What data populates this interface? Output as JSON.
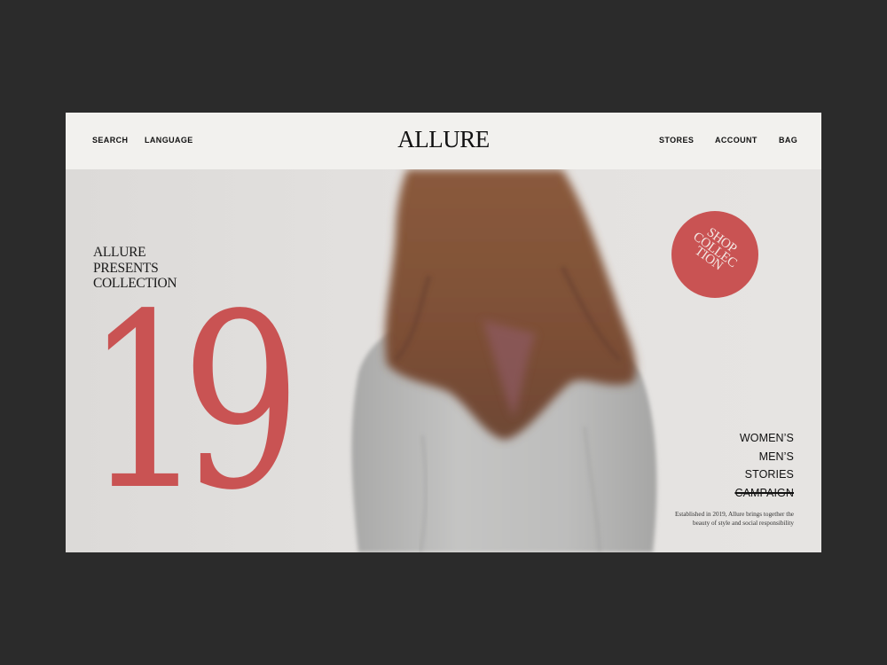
{
  "header": {
    "left_links": [
      "SEARCH",
      "LANGUAGE"
    ],
    "brand": "ALLURE",
    "right_links": [
      "STORES",
      "ACCOUNT",
      "BAG"
    ]
  },
  "hero": {
    "intro_lines": [
      "ALLURE",
      "PRESENTS",
      "COLLECTION"
    ],
    "collection_number": "19",
    "badge_lines": [
      "SHOP",
      "COLLEC",
      "TION"
    ],
    "categories": [
      "WOMEN’S",
      "MEN’S",
      "STORIES",
      "CAMPAIGN"
    ],
    "tagline_lines": [
      "Established in 2019, Allure brings together the",
      "beauty of style and social responsibility"
    ]
  },
  "colors": {
    "accent": "#c95353",
    "page_background": "#2b2b2b",
    "header_background": "#f2f1ee"
  },
  "image": {
    "description_icon": "woman-hair-flip-photo"
  }
}
